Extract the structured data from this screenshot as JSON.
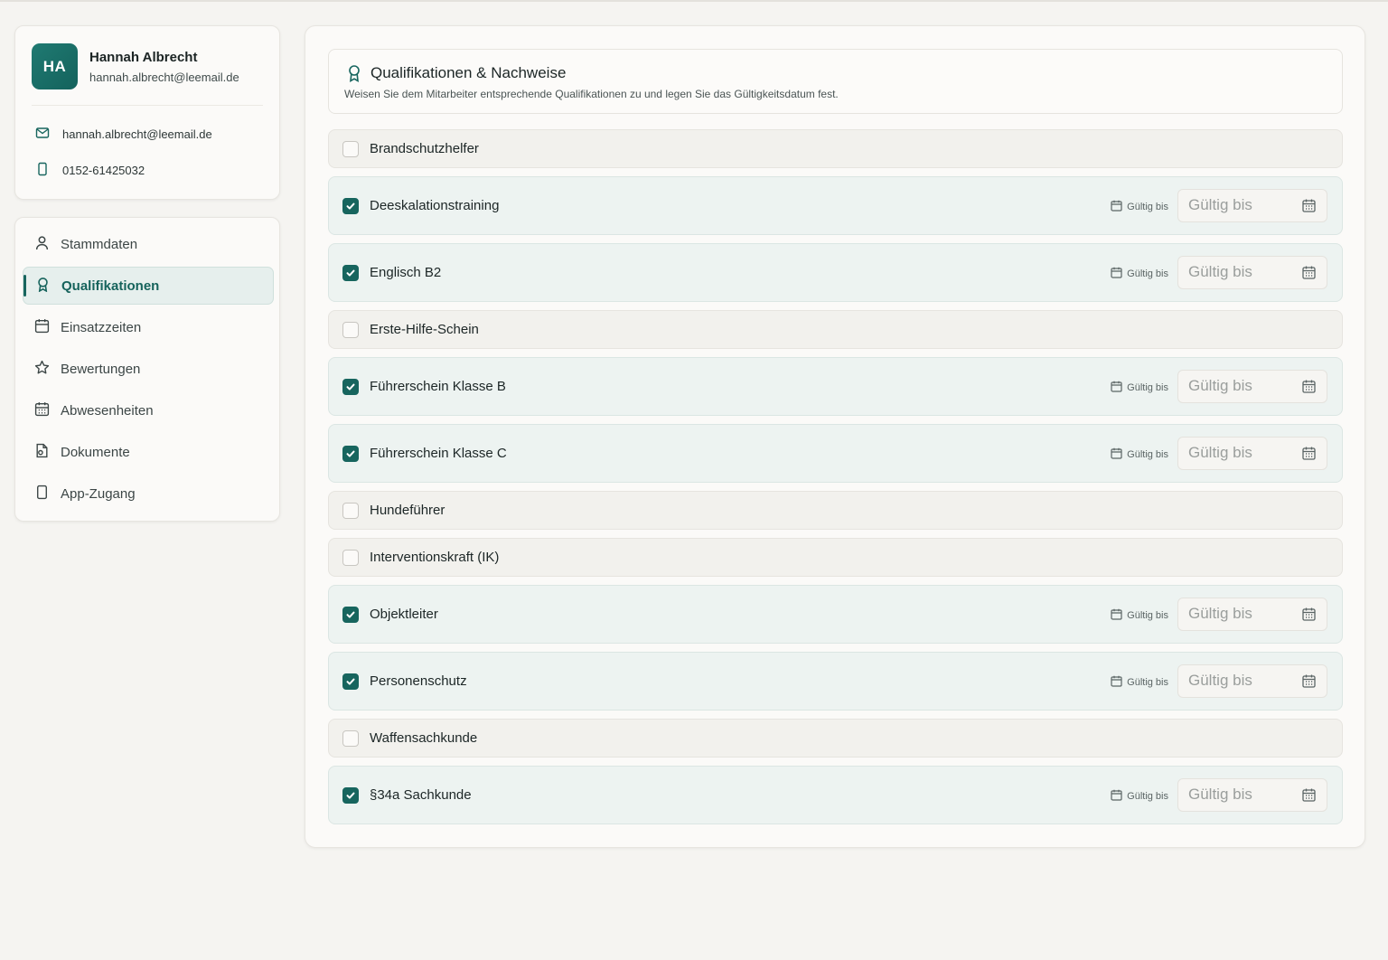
{
  "profile": {
    "initials": "HA",
    "name": "Hannah Albrecht",
    "email": "hannah.albrecht@leemail.de",
    "contact_email": "hannah.albrecht@leemail.de",
    "phone": "0152-61425032"
  },
  "nav": {
    "items": [
      {
        "label": "Stammdaten",
        "icon": "user-icon"
      },
      {
        "label": "Qualifikationen",
        "icon": "award-icon",
        "active": true
      },
      {
        "label": "Einsatzzeiten",
        "icon": "calendar-icon"
      },
      {
        "label": "Bewertungen",
        "icon": "star-icon"
      },
      {
        "label": "Abwesenheiten",
        "icon": "calendar-grid-icon"
      },
      {
        "label": "Dokumente",
        "icon": "document-icon"
      },
      {
        "label": "App-Zugang",
        "icon": "smartphone-icon"
      }
    ]
  },
  "section": {
    "title": "Qualifikationen & Nachweise",
    "subtitle": "Weisen Sie dem Mitarbeiter entsprechende Qualifikationen zu und legen Sie das Gültigkeitsdatum fest."
  },
  "valid_label": "Gültig bis",
  "date_placeholder": "Gültig bis",
  "qualifications": [
    {
      "label": "Brandschutzhelfer",
      "checked": false
    },
    {
      "label": "Deeskalationstraining",
      "checked": true
    },
    {
      "label": "Englisch B2",
      "checked": true
    },
    {
      "label": "Erste-Hilfe-Schein",
      "checked": false
    },
    {
      "label": "Führerschein Klasse B",
      "checked": true
    },
    {
      "label": "Führerschein Klasse C",
      "checked": true
    },
    {
      "label": "Hundeführer",
      "checked": false
    },
    {
      "label": "Interventionskraft (IK)",
      "checked": false
    },
    {
      "label": "Objektleiter",
      "checked": true
    },
    {
      "label": "Personenschutz",
      "checked": true
    },
    {
      "label": "Waffensachkunde",
      "checked": false
    },
    {
      "label": "§34a Sachkunde",
      "checked": true
    }
  ],
  "colors": {
    "accent": "#17655e",
    "checked_row_bg": "#edf3f1",
    "page_bg": "#f5f4f1"
  }
}
